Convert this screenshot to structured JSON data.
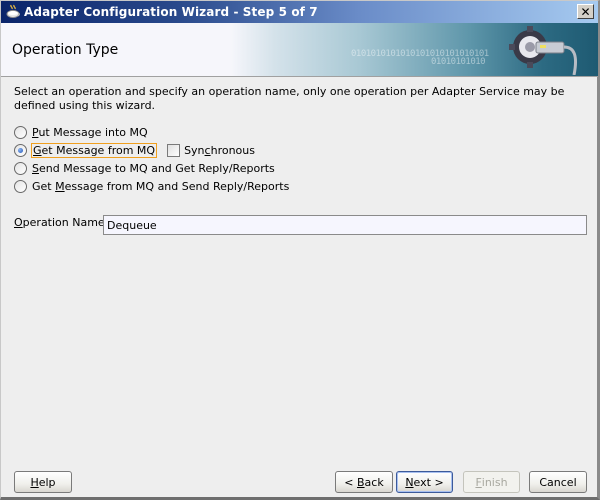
{
  "window": {
    "title": "Adapter Configuration Wizard - Step 5 of 7",
    "close_icon": "close-x-icon",
    "app_icon": "java-cup-icon"
  },
  "header": {
    "title": "Operation Type",
    "banner_text_1": "0101010101010101010101010101",
    "banner_text_2": "01010101010",
    "banner_icon": "gear-plug-icon"
  },
  "main": {
    "description": "Select an operation and specify an operation name, only one operation per Adapter Service may be defined using this wizard.",
    "operations": [
      {
        "pre": "",
        "mnemonic": "P",
        "post": "ut Message into MQ",
        "checked": false
      },
      {
        "pre": "",
        "mnemonic": "G",
        "post": "et Message from MQ",
        "checked": true
      },
      {
        "pre": "",
        "mnemonic": "S",
        "post": "end Message to MQ and Get Reply/Reports",
        "checked": false
      },
      {
        "pre": "Get ",
        "mnemonic": "M",
        "post": "essage from MQ and Send Reply/Reports",
        "checked": false
      }
    ],
    "synchronous": {
      "pre": "Syn",
      "mnemonic": "c",
      "post": "hronous",
      "checked": false
    },
    "operation_name": {
      "label_mnemonic": "O",
      "label_rest": "peration Name",
      "value": "Dequeue"
    }
  },
  "buttons": {
    "help": {
      "mnemonic": "H",
      "rest": "elp"
    },
    "back": {
      "pre": "< ",
      "mnemonic": "B",
      "rest": "ack"
    },
    "next": {
      "mnemonic": "N",
      "rest": "ext >"
    },
    "finish": {
      "mnemonic": "F",
      "rest": "inish",
      "enabled": false
    },
    "cancel": {
      "label": "Cancel"
    }
  }
}
